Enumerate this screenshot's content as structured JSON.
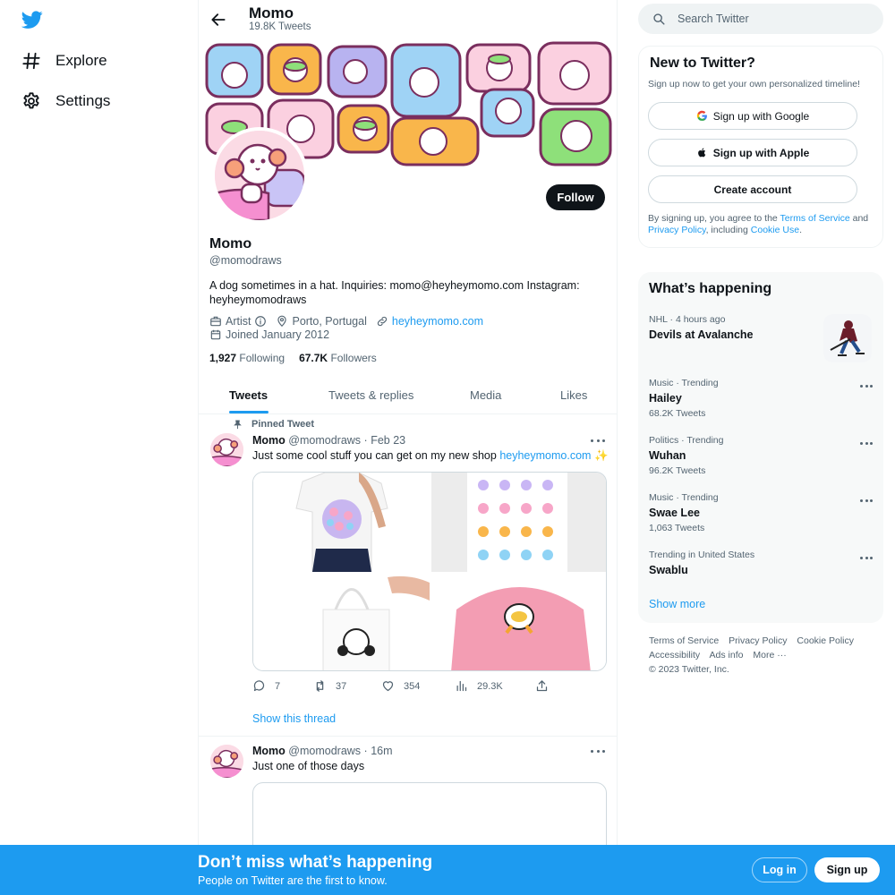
{
  "nav": {
    "items": [
      {
        "label": "Explore",
        "icon": "hashtag-icon"
      },
      {
        "label": "Settings",
        "icon": "gear-icon"
      }
    ]
  },
  "profile": {
    "name": "Momo",
    "tweet_count": "19.8K Tweets",
    "handle": "@momodraws",
    "bio": "A dog sometimes in a hat. Inquiries: momo@heyheymomo.com Instagram: heyheymomodraws",
    "category": "Artist",
    "location": "Porto, Portugal",
    "website": "heyheymomo.com",
    "joined": "Joined January 2012",
    "following_count": "1,927",
    "following_label": "Following",
    "followers_count": "67.7K",
    "followers_label": "Followers",
    "follow_label": "Follow"
  },
  "tabs": [
    "Tweets",
    "Tweets & replies",
    "Media",
    "Likes"
  ],
  "tweets": [
    {
      "pinned_label": "Pinned Tweet",
      "name": "Momo",
      "handle": "@momodraws",
      "sep": "·",
      "time": "Feb 23",
      "text": "Just some cool stuff you can get on my new shop",
      "link": "heyheymomo.com",
      "emoji": "✨",
      "replies": "7",
      "retweets": "37",
      "likes": "354",
      "views": "29.3K",
      "show_thread": "Show this thread"
    },
    {
      "name": "Momo",
      "handle": "@momodraws",
      "sep": "·",
      "time": "16m",
      "text": "Just one of those days"
    }
  ],
  "search": {
    "placeholder": "Search Twitter"
  },
  "signup": {
    "title": "New to Twitter?",
    "subtitle": "Sign up now to get your own personalized timeline!",
    "google": "Sign up with Google",
    "apple": "Sign up with Apple",
    "create": "Create account",
    "legal_1": "By signing up, you agree to the",
    "terms": "Terms of Service",
    "and": "and",
    "privacy": "Privacy Policy",
    "including": ", including",
    "cookie": "Cookie Use",
    "period": "."
  },
  "trends": {
    "title": "What’s happening",
    "items": [
      {
        "category": "NHL · 4 hours ago",
        "name": "Devils at Avalanche",
        "count": ""
      },
      {
        "category": "Music · Trending",
        "name": "Hailey",
        "count": "68.2K Tweets"
      },
      {
        "category": "Politics · Trending",
        "name": "Wuhan",
        "count": "96.2K Tweets"
      },
      {
        "category": "Music · Trending",
        "name": "Swae Lee",
        "count": "1,063 Tweets"
      },
      {
        "category": "Trending in United States",
        "name": "Swablu",
        "count": ""
      }
    ],
    "show_more": "Show more"
  },
  "footer": {
    "links": [
      "Terms of Service",
      "Privacy Policy",
      "Cookie Policy",
      "Accessibility",
      "Ads info",
      "More ···"
    ],
    "copyright": "© 2023 Twitter, Inc."
  },
  "bottom_banner": {
    "title": "Don’t miss what’s happening",
    "subtitle": "People on Twitter are the first to know.",
    "login": "Log in",
    "signup": "Sign up"
  },
  "colors": {
    "accent": "#1d9bf0",
    "text": "#0f1419",
    "muted": "#536471",
    "border": "#eff3f4"
  }
}
